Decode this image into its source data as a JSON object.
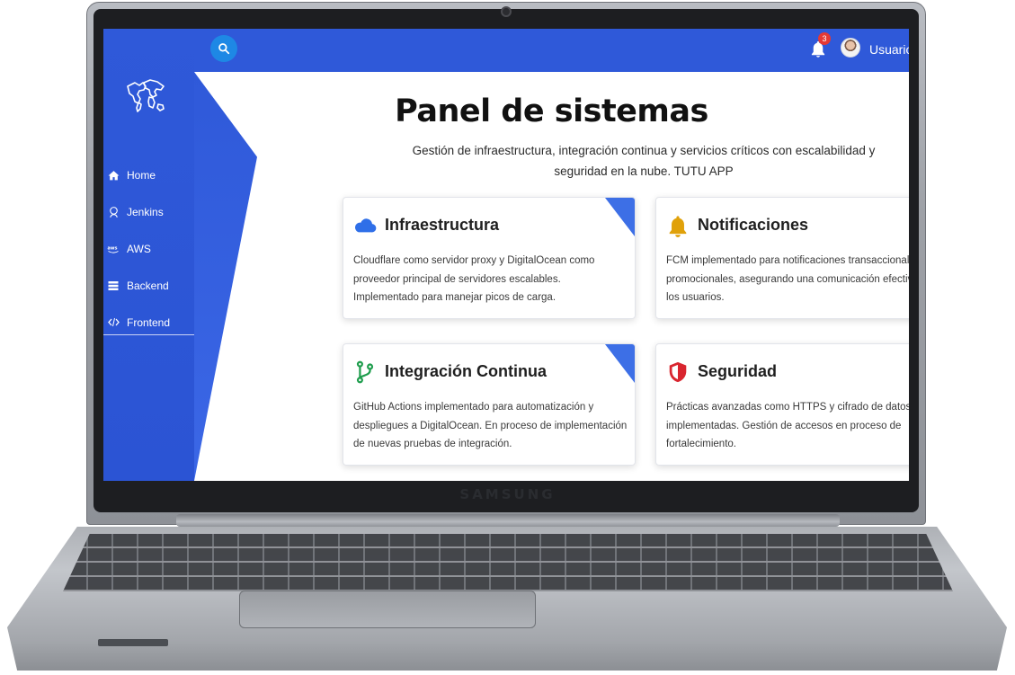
{
  "device": {
    "brand": "SAMSUNG"
  },
  "topbar": {
    "notification_count": "3",
    "username": "Usuario"
  },
  "sidebar": {
    "items": [
      {
        "label": "Home",
        "icon": "home-icon"
      },
      {
        "label": "Jenkins",
        "icon": "jenkins-icon"
      },
      {
        "label": "AWS",
        "icon": "aws-icon"
      },
      {
        "label": "Backend",
        "icon": "server-icon"
      },
      {
        "label": "Frontend",
        "icon": "code-icon"
      }
    ]
  },
  "main": {
    "title": "Panel de sistemas",
    "subtitle": "Gestión de infraestructura, integración continua y servicios críticos con escalabilidad y seguridad en la nube. TUTU APP",
    "cards": [
      {
        "title": "Infraestructura",
        "icon": "cloud-icon",
        "text": "Cloudflare como servidor proxy y DigitalOcean como proveedor principal de servidores escalables. Implementado para manejar picos de carga."
      },
      {
        "title": "Notificaciones",
        "icon": "bell-icon",
        "text": "FCM implementado para notificaciones transaccionales y promocionales, asegurando una comunicación efectiva con los usuarios."
      },
      {
        "title": "Integración Continua",
        "icon": "git-branch-icon",
        "text": "GitHub Actions implementado para automatización y despliegues a DigitalOcean. En proceso de implementación de nuevas pruebas de integración."
      },
      {
        "title": "Seguridad",
        "icon": "shield-icon",
        "text": "Prácticas avanzadas como HTTPS y cifrado de datos están implementadas. Gestión de accesos en proceso de fortalecimiento."
      }
    ]
  },
  "colors": {
    "primary": "#2f59d9",
    "card_corner": "#3d6fe6",
    "cloud": "#2f6fe8",
    "bell": "#e0a10a",
    "git": "#1f9d4d",
    "shield": "#d9252f"
  }
}
